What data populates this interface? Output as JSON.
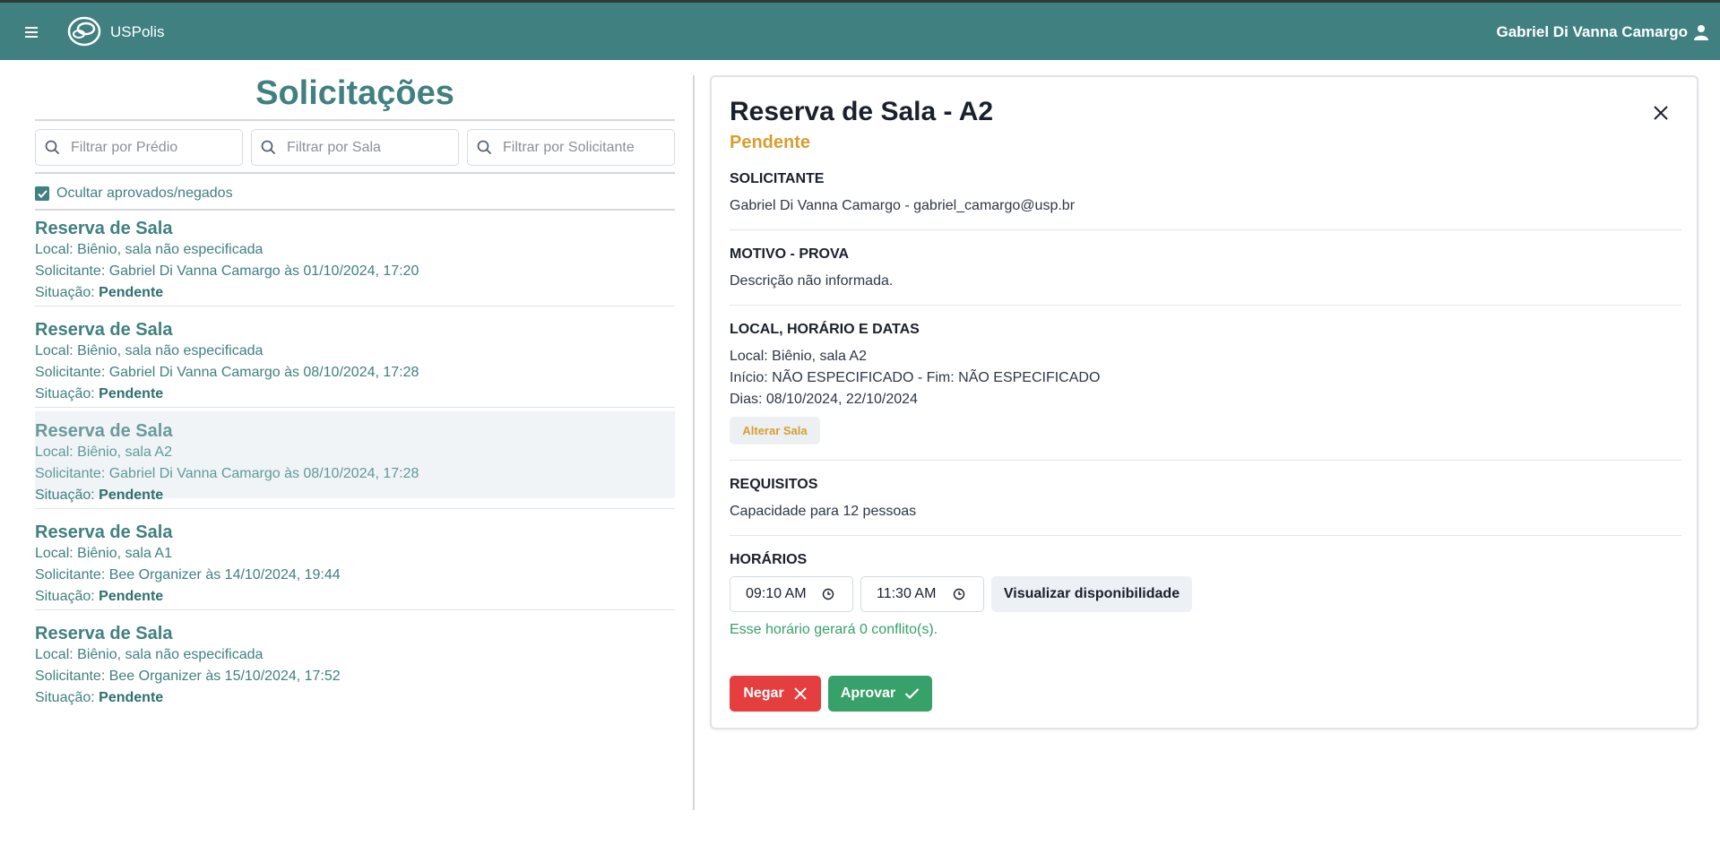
{
  "header": {
    "app_name": "USPolis",
    "user_name": "Gabriel Di Vanna Camargo",
    "brand_color": "#408080",
    "menu_icon": "hamburger-icon",
    "logo_icon": "uspolis-logo",
    "user_icon": "user-icon"
  },
  "left": {
    "title": "Solicitações",
    "filters": {
      "building_placeholder": "Filtrar por Prédio",
      "room_placeholder": "Filtrar por Sala",
      "requester_placeholder": "Filtrar por Solicitante"
    },
    "hide_label": "Ocultar aprovados/negados",
    "hide_checked": true,
    "status_prefix": "Situação: ",
    "requests": [
      {
        "title": "Reserva de Sala",
        "local": "Local: Biênio, sala não especificada",
        "requester": "Solicitante: Gabriel Di Vanna Camargo às 01/10/2024, 17:20",
        "status": "Pendente"
      },
      {
        "title": "Reserva de Sala",
        "local": "Local: Biênio, sala não especificada",
        "requester": "Solicitante: Gabriel Di Vanna Camargo às 08/10/2024, 17:28",
        "status": "Pendente"
      },
      {
        "title": "Reserva de Sala",
        "local": "Local: Biênio, sala A2",
        "requester": "Solicitante: Gabriel Di Vanna Camargo às 08/10/2024, 17:28",
        "status": "Pendente"
      },
      {
        "title": "Reserva de Sala",
        "local": "Local: Biênio, sala A1",
        "requester": "Solicitante: Bee Organizer às 14/10/2024, 19:44",
        "status": "Pendente"
      },
      {
        "title": "Reserva de Sala",
        "local": "Local: Biênio, sala não especificada",
        "requester": "Solicitante: Bee Organizer às 15/10/2024, 17:52",
        "status": "Pendente"
      }
    ]
  },
  "detail": {
    "title": "Reserva de Sala - A2",
    "status": "Pendente",
    "requester_heading": "SOLICITANTE",
    "requester_text": "Gabriel Di Vanna Camargo - gabriel_camargo@usp.br",
    "reason_heading": "MOTIVO - PROVA",
    "reason_text": "Descrição não informada.",
    "location_heading": "LOCAL, HORÁRIO E DATAS",
    "location_local": "Local: Biênio, sala A2",
    "location_time": "Início: NÃO ESPECIFICADO - Fim: NÃO ESPECIFICADO",
    "location_days": "Dias: 08/10/2024, 22/10/2024",
    "change_room_label": "Alterar Sala",
    "requirements_heading": "REQUISITOS",
    "requirements_text": "Capacidade para 12 pessoas",
    "schedule_heading": "HORÁRIOS",
    "start_time": "09:10 AM",
    "end_time": "11:30 AM",
    "availability_label": "Visualizar disponibilidade",
    "conflict_text": "Esse horário gerará 0 conflito(s).",
    "deny_label": "Negar",
    "approve_label": "Aprovar",
    "colors": {
      "pending": "#d69e2e",
      "deny": "#e53e3e",
      "approve": "#38a169"
    }
  }
}
